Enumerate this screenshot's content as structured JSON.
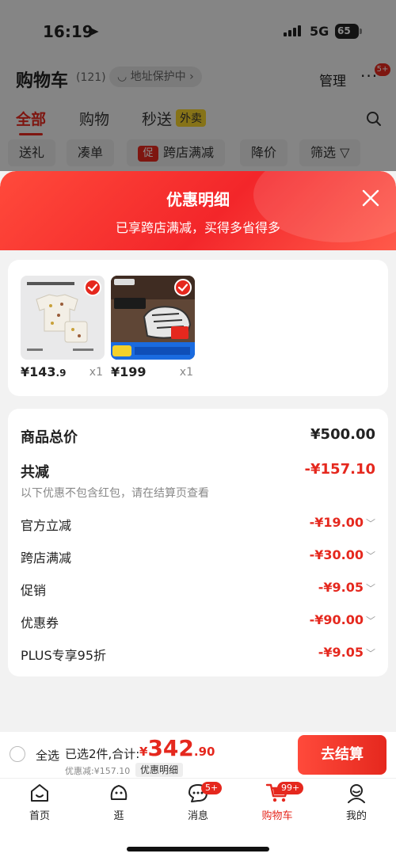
{
  "status_bar": {
    "time": "16:19",
    "network": "5G",
    "battery": "65"
  },
  "header": {
    "title": "购物车",
    "count": "(121)",
    "address_protect": "◡ 地址保护中 ›",
    "manage": "管理",
    "more": "···",
    "more_badge": "5+"
  },
  "tabs": [
    {
      "label": "全部",
      "active": true
    },
    {
      "label": "购物"
    },
    {
      "label": "秒送"
    }
  ],
  "tab_badge": "外卖",
  "filters": [
    "送礼",
    "凑单",
    "跨店满减",
    "降价",
    "筛选 ▽"
  ],
  "filter_tag": "促",
  "sheet": {
    "title": "优惠明细",
    "subtitle": "已享跨店满减，买得多省得多",
    "products": [
      {
        "price_int": "¥143",
        "price_dec": ".9",
        "qty": "x1"
      },
      {
        "price_int": "¥199",
        "price_dec": "",
        "qty": "x1"
      }
    ],
    "summary": {
      "total_label": "商品总价",
      "total_value": "¥500.00",
      "reduce_label": "共减",
      "reduce_value": "-¥157.10",
      "note": "以下优惠不包含红包，请在结算页查看",
      "items": [
        {
          "label": "官方立减",
          "value": "-¥19.00"
        },
        {
          "label": "跨店满减",
          "value": "-¥30.00"
        },
        {
          "label": "促销",
          "value": "-¥9.05"
        },
        {
          "label": "优惠券",
          "value": "-¥90.00"
        },
        {
          "label": "PLUS专享95折",
          "value": "-¥9.05"
        }
      ]
    }
  },
  "checkout": {
    "select_all": "全选",
    "selected_info": "已选2件,合计:",
    "currency": "¥",
    "total_int": "342",
    "total_dec": ".90",
    "discount": "优惠减:¥157.10",
    "detail_link": "优惠明细",
    "pay_button": "去结算"
  },
  "tabbar": [
    {
      "label": "首页",
      "icon": "home-icon"
    },
    {
      "label": "逛",
      "icon": "explore-icon"
    },
    {
      "label": "消息",
      "icon": "message-icon",
      "badge": "5+"
    },
    {
      "label": "购物车",
      "icon": "cart-icon",
      "badge": "99+",
      "active": true
    },
    {
      "label": "我的",
      "icon": "profile-icon"
    }
  ],
  "colors": {
    "accent": "#e5281e",
    "background": "#f2f2f2"
  }
}
